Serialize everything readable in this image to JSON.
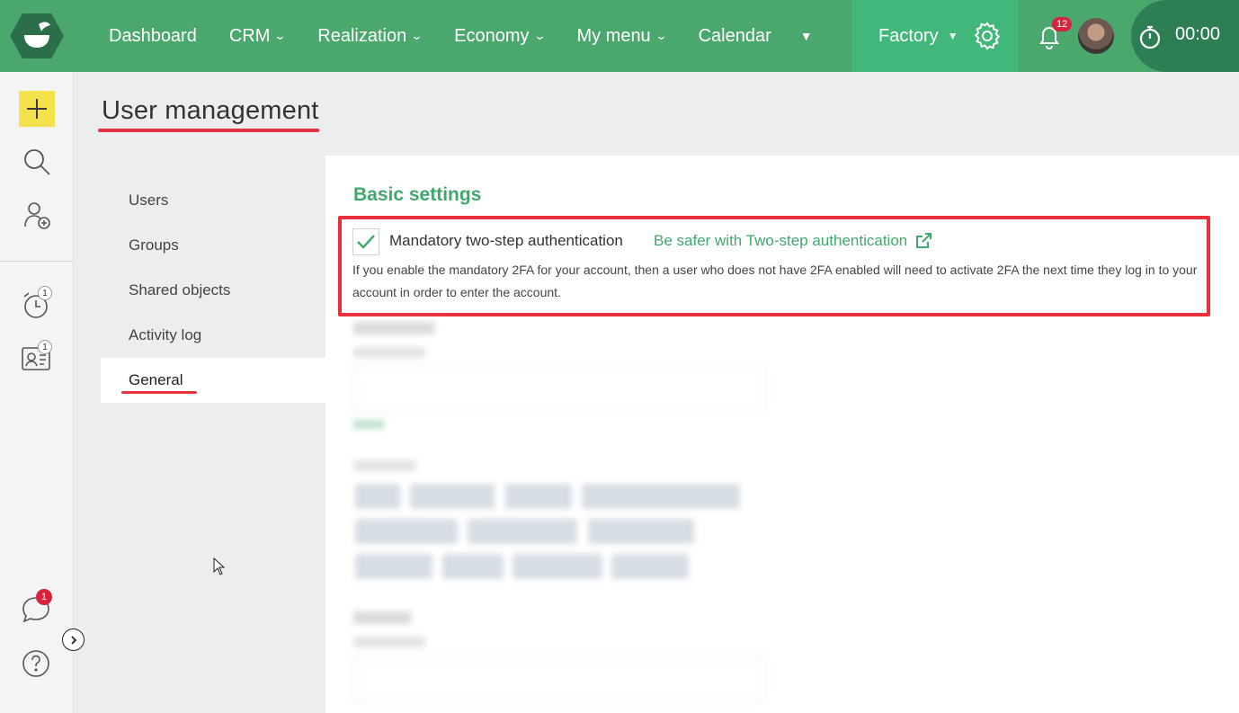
{
  "nav": {
    "items": [
      {
        "label": "Dashboard",
        "has_chevron": false
      },
      {
        "label": "CRM",
        "has_chevron": true
      },
      {
        "label": "Realization",
        "has_chevron": true
      },
      {
        "label": "Economy",
        "has_chevron": true
      },
      {
        "label": "My menu",
        "has_chevron": true
      },
      {
        "label": "Calendar",
        "has_chevron": false
      }
    ],
    "more_icon": "caret-down-icon",
    "workspace": "Factory",
    "notification_count": "12",
    "timer": "00:00"
  },
  "rail": {
    "alarm_count": "1",
    "contact_count": "1",
    "chat_count": "1"
  },
  "page": {
    "title": "User management"
  },
  "subnav": {
    "items": [
      "Users",
      "Groups",
      "Shared objects",
      "Activity log",
      "General"
    ],
    "active": "General"
  },
  "settings": {
    "section_title": "Basic settings",
    "two_factor": {
      "label": "Mandatory two-step authentication",
      "checked": true,
      "link_label": "Be safer with Two-step authentication",
      "description": "If you enable the mandatory 2FA for your account, then a user who does not have 2FA enabled will need to activate 2FA the next time they log in to your account in order to enter the account."
    }
  },
  "colors": {
    "topbar": "#4aa86c",
    "accent_green": "#3ea96b",
    "highlight_red": "#e8303f",
    "badge_red": "#d7233c",
    "add_button": "#f3e24c"
  }
}
